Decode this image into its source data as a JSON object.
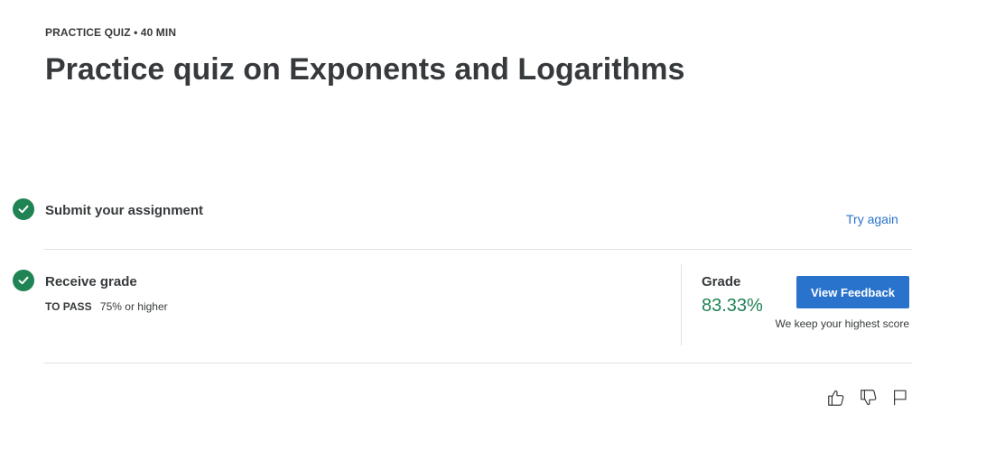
{
  "header": {
    "eyebrow": "PRACTICE QUIZ • 40 MIN",
    "title": "Practice quiz on Exponents and Logarithms"
  },
  "steps": {
    "submit": {
      "label": "Submit your assignment",
      "action_link": "Try again",
      "status": "complete"
    },
    "grade": {
      "label": "Receive grade",
      "pass_label": "TO PASS",
      "pass_requirement": "75% or higher",
      "status": "complete",
      "grade_label": "Grade",
      "grade_value": "83.33%",
      "feedback_button": "View Feedback",
      "note": "We keep your highest score"
    }
  },
  "icons": {
    "check": "check-circle-icon",
    "like": "thumbs-up-icon",
    "dislike": "thumbs-down-icon",
    "flag": "flag-icon"
  },
  "colors": {
    "success": "#1f8354",
    "primary": "#2a73cc",
    "text": "#373a3c",
    "divider": "#e1e1e1"
  }
}
